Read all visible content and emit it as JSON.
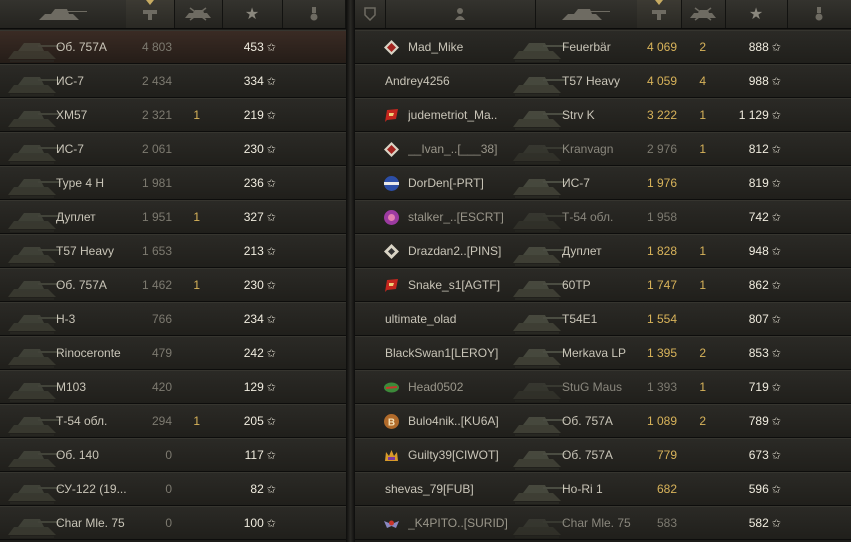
{
  "colors": {
    "gold": "#d8b35a",
    "text": "#c9c5b8",
    "dim": "#7d7a70",
    "xp": "#f0ecdf"
  },
  "headers": {
    "left": {
      "icons": [
        "tank-icon",
        "damage-icon",
        "kills-icon",
        "experience-icon",
        "medal-icon"
      ]
    },
    "right": {
      "icons": [
        "platoon-icon",
        "player-icon",
        "tank-icon",
        "damage-icon",
        "kills-icon",
        "experience-icon",
        "medal-icon"
      ]
    }
  },
  "left_rows": [
    {
      "vehicle": "Об. 757А",
      "damage": "4 803",
      "kills": "",
      "xp": "453"
    },
    {
      "vehicle": "ИС-7",
      "damage": "2 434",
      "kills": "",
      "xp": "334"
    },
    {
      "vehicle": "XM57",
      "damage": "2 321",
      "kills": "1",
      "xp": "219"
    },
    {
      "vehicle": "ИС-7",
      "damage": "2 061",
      "kills": "",
      "xp": "230"
    },
    {
      "vehicle": "Type 4 H",
      "damage": "1 981",
      "kills": "",
      "xp": "236"
    },
    {
      "vehicle": "Дуплет",
      "damage": "1 951",
      "kills": "1",
      "xp": "327"
    },
    {
      "vehicle": "T57 Heavy",
      "damage": "1 653",
      "kills": "",
      "xp": "213"
    },
    {
      "vehicle": "Об. 757А",
      "damage": "1 462",
      "kills": "1",
      "xp": "230"
    },
    {
      "vehicle": "Н-3",
      "damage": "766",
      "kills": "",
      "xp": "234"
    },
    {
      "vehicle": "Rinoceronte",
      "damage": "479",
      "kills": "",
      "xp": "242"
    },
    {
      "vehicle": "M103",
      "damage": "420",
      "kills": "",
      "xp": "129"
    },
    {
      "vehicle": "Т-54 обл.",
      "damage": "294",
      "kills": "1",
      "xp": "205"
    },
    {
      "vehicle": "Об. 140",
      "damage": "0",
      "kills": "",
      "xp": "117"
    },
    {
      "vehicle": "СУ-122 (19...",
      "damage": "0",
      "kills": "",
      "xp": "82"
    },
    {
      "vehicle": "Char Mle. 75",
      "damage": "0",
      "kills": "",
      "xp": "100"
    }
  ],
  "right_rows": [
    {
      "player": "Mad_Mike",
      "badge": "rank-1-icon",
      "vehicle": "Feuerbär",
      "damage": "4 069",
      "kills": "2",
      "xp": "888",
      "alive": true
    },
    {
      "player": "Andrey4256",
      "badge": "",
      "vehicle": "T57 Heavy",
      "damage": "4 059",
      "kills": "4",
      "xp": "988",
      "alive": true
    },
    {
      "player": "judemetriot_Ma..",
      "badge": "flag-badge-icon",
      "vehicle": "Strv K",
      "damage": "3 222",
      "kills": "1",
      "xp": "1 129",
      "alive": true
    },
    {
      "player": "__Ivan_..[___38]",
      "badge": "rank-1-icon",
      "vehicle": "Kranvagn",
      "damage": "2 976",
      "kills": "1",
      "xp": "812",
      "alive": false
    },
    {
      "player": "DorDen[-PRT]",
      "badge": "usa-badge-icon",
      "vehicle": "ИС-7",
      "damage": "1 976",
      "kills": "",
      "xp": "819",
      "alive": true
    },
    {
      "player": "stalker_..[ESCRT]",
      "badge": "shield-badge-icon",
      "vehicle": "Т-54 обл.",
      "damage": "1 958",
      "kills": "",
      "xp": "742",
      "alive": false
    },
    {
      "player": "Drazdan2..[PINS]",
      "badge": "diamond-badge-icon",
      "vehicle": "Дуплет",
      "damage": "1 828",
      "kills": "1",
      "xp": "948",
      "alive": true
    },
    {
      "player": "Snake_s1[AGTF]",
      "badge": "flag-badge-icon",
      "vehicle": "60TP",
      "damage": "1 747",
      "kills": "1",
      "xp": "862",
      "alive": true
    },
    {
      "player": "ultimate_olad",
      "badge": "",
      "vehicle": "T54E1",
      "damage": "1 554",
      "kills": "",
      "xp": "807",
      "alive": true
    },
    {
      "player": "BlackSwan1[LEROY]",
      "badge": "",
      "vehicle": "Merkava LP",
      "damage": "1 395",
      "kills": "2",
      "xp": "853",
      "alive": true
    },
    {
      "player": "Head0502",
      "badge": "leaf-badge-icon",
      "vehicle": "StuG Maus",
      "damage": "1 393",
      "kills": "1",
      "xp": "719",
      "alive": false
    },
    {
      "player": "Bulo4nik..[KU6A]",
      "badge": "b-badge-icon",
      "vehicle": "Об. 757А",
      "damage": "1 089",
      "kills": "2",
      "xp": "789",
      "alive": true
    },
    {
      "player": "Guilty39[CIWOT]",
      "badge": "crown-badge-icon",
      "vehicle": "Об. 757А",
      "damage": "779",
      "kills": "",
      "xp": "673",
      "alive": true
    },
    {
      "player": "shevas_79[FUB]",
      "badge": "",
      "vehicle": "Ho-Ri 1",
      "damage": "682",
      "kills": "",
      "xp": "596",
      "alive": true
    },
    {
      "player": "_K4PITO..[SURID]",
      "badge": "wing-badge-icon",
      "vehicle": "Char Mle. 75",
      "damage": "583",
      "kills": "",
      "xp": "582",
      "alive": false
    }
  ]
}
